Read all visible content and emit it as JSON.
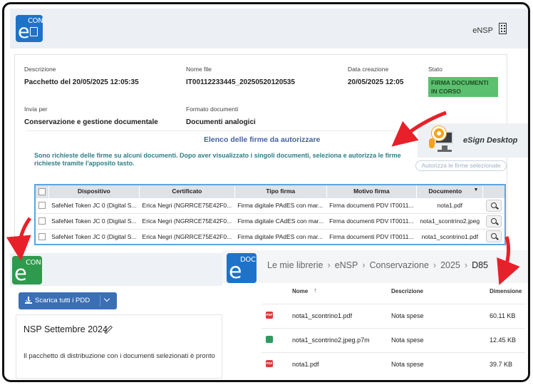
{
  "top": {
    "logo_main": "e",
    "logo_sup": "CON",
    "org": "eNSP",
    "fields": {
      "descrizione_label": "Descrizione",
      "descrizione_value": "Pacchetto del 20/05/2025 12:05:35",
      "nome_file_label": "Nome file",
      "nome_file_value": "IT00112233445_20250520120535",
      "data_creazione_label": "Data creazione",
      "data_creazione_value": "20/05/2025 12:05",
      "stato_label": "Stato",
      "stato_value": "FIRMA DOCUMENTI IN CORSO",
      "invia_per_label": "Invia per",
      "invia_per_value": "Conservazione e gestione documentale",
      "formato_label": "Formato documenti",
      "formato_value": "Documenti analogici"
    },
    "section_title": "Elenco delle firme da autorizzare",
    "notice": "Sono richieste delle firme su alcuni documenti. Dopo aver visualizzato i singoli documenti, seleziona e autorizza le firme richieste tramite l'apposito tasto.",
    "authorize_button": "Autorizza le firme selezionate",
    "table": {
      "headers": [
        "Dispositivo",
        "Certificato",
        "Tipo firma",
        "Motivo firma",
        "Documento"
      ],
      "rows": [
        [
          "SafeNet Token JC 0 (Digital S...",
          "Erica Negri (NGRRCE75E42F0...",
          "Firma digitale PAdES con mar...",
          "Firma documenti PDV IT0011...",
          "nota1.pdf"
        ],
        [
          "SafeNet Token JC 0 (Digital S...",
          "Erica Negri (NGRRCE75E42F0...",
          "Firma digitale CAdES con mar...",
          "Firma documenti PDV IT0011...",
          "nota1_scontrino2.jpeg"
        ],
        [
          "SafeNet Token JC 0 (Digital S...",
          "Erica Negri (NGRRCE75E42F0...",
          "Firma digitale PAdES con mar...",
          "Firma documenti PDV IT0011...",
          "nota1_scontrino1.pdf"
        ]
      ]
    },
    "esign_label": "eSign Desktop"
  },
  "bottom_left": {
    "logo_main": "e",
    "logo_sup": "CON",
    "download_button": "Scarica tutti i PDD",
    "title": "NSP Settembre 2024",
    "description": "Il pacchetto di distribuzione con i documenti selezionati è pronto"
  },
  "bottom_right": {
    "logo_main": "e",
    "logo_sup": "DOC",
    "breadcrumb": [
      "Le mie librerie",
      "eNSP",
      "Conservazione",
      "2025",
      "D85"
    ],
    "headers": {
      "name": "Nome",
      "description": "Descrizione",
      "size": "Dimensione"
    },
    "files": [
      {
        "type": "pdf",
        "type_label": "PDF",
        "name": "nota1_scontrino1.pdf",
        "description": "Nota spese",
        "size": "60.11 KB"
      },
      {
        "type": "img",
        "type_label": "",
        "name": "nota1_scontrino2.jpeg.p7m",
        "description": "Nota spese",
        "size": "12.45 KB"
      },
      {
        "type": "pdf",
        "type_label": "PDF",
        "name": "nota1.pdf",
        "description": "Nota spese",
        "size": "39.7 KB"
      }
    ]
  },
  "colors": {
    "accent": "#1e73c8",
    "badge": "#5bc06f",
    "arrow": "#e8202a",
    "notice": "#2f7e87",
    "title": "#44639a"
  }
}
